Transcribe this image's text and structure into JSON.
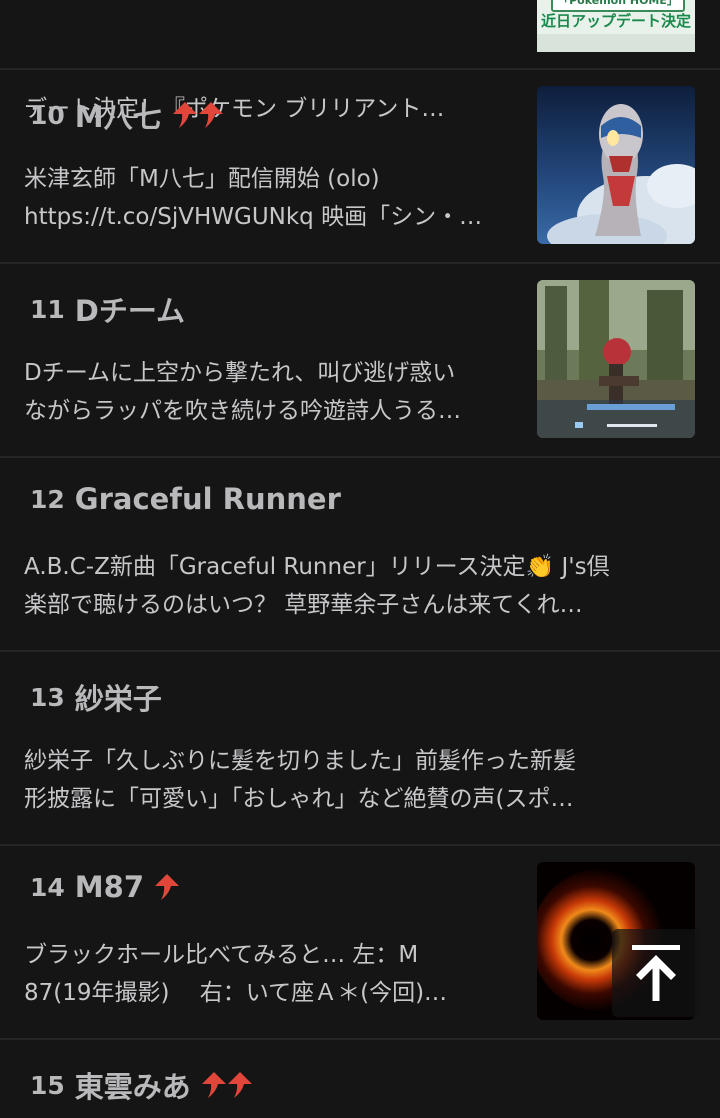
{
  "colors": {
    "background": "#151516",
    "divider": "#262628",
    "rank_text": "#b9b9bb",
    "desc_text": "#c7c7c9",
    "trend_arrow": "#e0473a"
  },
  "top_item": {
    "desc_line": "デート決定！『ポケモン ブリリアント…",
    "thumb_text_1": "「Pokemon HOME」",
    "thumb_text_2": "近日アップデート決定"
  },
  "items": [
    {
      "rank": "10",
      "title": "M八七",
      "trend": "up-up",
      "desc_lines": [
        "米津玄師「M八七」配信開始 (olo)",
        "https://t.co/SjVHWGUNkq 映画「シン・…"
      ],
      "thumbnail": "ultraman-image"
    },
    {
      "rank": "11",
      "title": "Dチーム",
      "trend": "none",
      "desc_lines": [
        "Dチームに上空から撃たれ、叫び逃げ惑い",
        "ながらラッパを吹き続ける吟遊詩人うる…"
      ],
      "thumbnail": "game-screenshot-image"
    },
    {
      "rank": "12",
      "title": "Graceful Runner",
      "trend": "none",
      "desc_lines": [
        "A.B.C-Z新曲「Graceful Runner」リリース決定👏 J's倶",
        "楽部で聴けるのはいつ？ 草野華余子さんは来てくれ…"
      ]
    },
    {
      "rank": "13",
      "title": "紗栄子",
      "trend": "none",
      "desc_lines": [
        "紗栄子「久しぶりに髪を切りました」前髪作った新髪",
        "形披露に「可愛い」「おしゃれ」など絶賛の声(スポ…"
      ]
    },
    {
      "rank": "14",
      "title": "M87",
      "trend": "up",
      "desc_lines": [
        "ブラックホール比べてみると… 左：M",
        "87(19年撮影)　 右：いて座Ａ＊(今回)…"
      ],
      "thumbnail": "black-hole-image"
    },
    {
      "rank": "15",
      "title": "東雲みあ",
      "trend": "up-up"
    }
  ],
  "back_to_top": {
    "icon": "arrow-up-to-top-icon"
  }
}
